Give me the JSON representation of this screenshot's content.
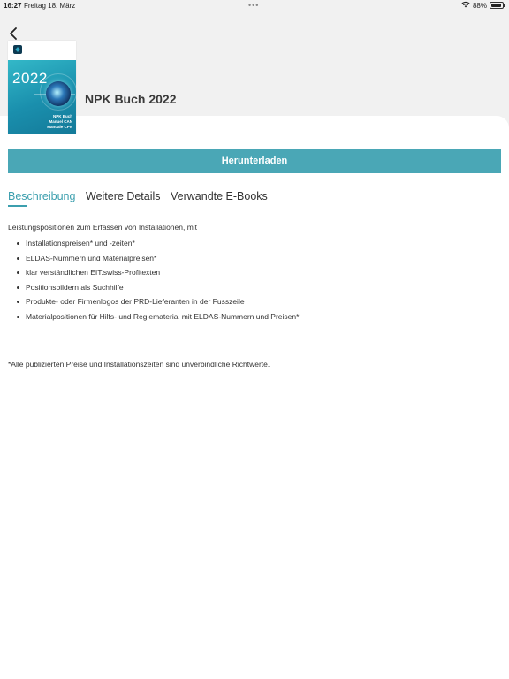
{
  "status_bar": {
    "time": "16:27",
    "date": "Freitag 18. März",
    "dots": "•••",
    "battery_percent": "88%",
    "battery_level": 0.88
  },
  "header": {
    "back_icon": "chevron-left-icon"
  },
  "book": {
    "title": "NPK Buch 2022",
    "cover": {
      "year": "2022",
      "lines": [
        "NPK Buch",
        "Manuel CAN",
        "Manuale CPN"
      ]
    }
  },
  "actions": {
    "download_label": "Herunterladen"
  },
  "tabs": [
    {
      "label": "Beschreibung",
      "active": true
    },
    {
      "label": "Weitere Details",
      "active": false
    },
    {
      "label": "Verwandte E-Books",
      "active": false
    }
  ],
  "description": {
    "intro": "Leistungspositionen zum Erfassen von Installationen, mit",
    "items": [
      "Installationspreisen* und -zeiten*",
      "ELDAS-Nummern und Materialpreisen*",
      "klar verständlichen EIT.swiss-Profitexten",
      "Positionsbildern als Suchhilfe",
      "Produkte- oder Firmenlogos der PRD-Lieferanten in der Fusszeile",
      "Materialpositionen für Hilfs- und Regiematerial mit ELDAS-Nummern und Preisen*"
    ],
    "footnote": "*Alle publizierten Preise und Installationszeiten sind unverbindliche Richtwerte."
  },
  "colors": {
    "accent": "#4aa7b6",
    "accent_text": "#3c9fae",
    "header_bg": "#f1f1f1"
  }
}
